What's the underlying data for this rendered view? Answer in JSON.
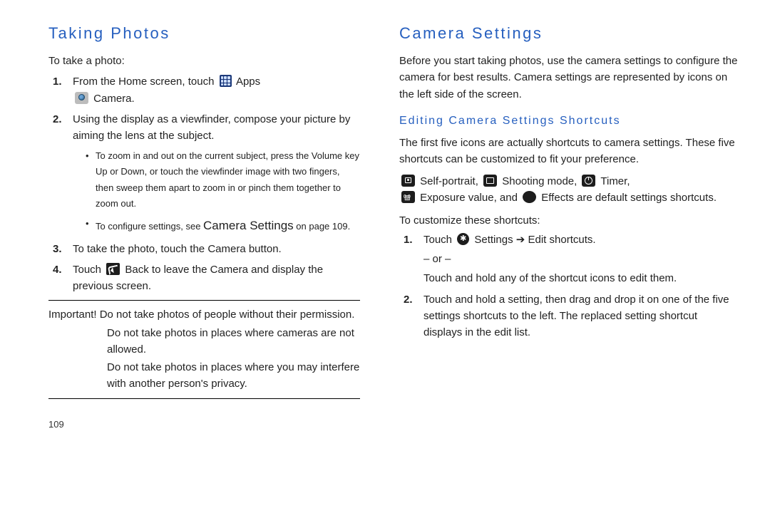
{
  "left": {
    "heading": "Taking Photos",
    "intro": "To take a photo:",
    "step1_pre": "From the Home screen, touch ",
    "step1_apps": " Apps",
    "step1_arrow": " ",
    "step1_camera": " Camera.",
    "step2": "Using the display as a viewfinder, compose your picture by aiming the lens at the subject.",
    "step2_bullet1": "To zoom in and out on the current subject, press the Volume key Up or Down, or touch the viewfinder image with two fingers, then sweep them apart to zoom in or pinch them together to zoom out.",
    "step2_bullet2_pre": "To configure settings, see ",
    "step2_bullet2_link": "Camera Settings",
    "step2_bullet2_post": " on page 109.",
    "step3_pre": "To take the photo, touch the ",
    "step3_btn": "Camera",
    "step3_post": " button.",
    "step4_pre": "Touch ",
    "step4_back": " Back",
    "step4_post": " to leave the Camera and display the previous screen.",
    "important_label": "Important! ",
    "imp1": "Do not take photos of people without their permission.",
    "imp2": "Do not take photos in places where cameras are not allowed.",
    "imp3": "Do not take photos in places where you may interfere with another person's privacy.",
    "pagenum": "109"
  },
  "right": {
    "heading": "Camera Settings",
    "intro": "Before you start taking photos, use the camera settings to configure the camera for best results. Camera settings are represented by icons on the left side of the screen.",
    "subheading": "Editing Camera Settings Shortcuts",
    "para1": "The first five icons are actually shortcuts to camera settings. These five shortcuts can be customized to fit your preference.",
    "sc_selfportrait": " Self-portrait, ",
    "sc_shooting": " Shooting mode, ",
    "sc_timer": " Timer,",
    "sc_exposure": " Exposure value, and ",
    "sc_effects": " Effects",
    "sc_tail": " are default settings shortcuts.",
    "customize_intro": "To customize these shortcuts:",
    "step1_pre": "Touch ",
    "step1_settings": " Settings",
    "step1_arrow": " ➔ ",
    "step1_edit": "Edit shortcuts",
    "step1_period": ".",
    "or": "– or –",
    "step1_alt": "Touch and hold any of the shortcut icons to edit them.",
    "step2": "Touch and hold a setting, then drag and drop it on one of the five settings shortcuts to the left. The replaced setting shortcut displays in the edit list."
  }
}
